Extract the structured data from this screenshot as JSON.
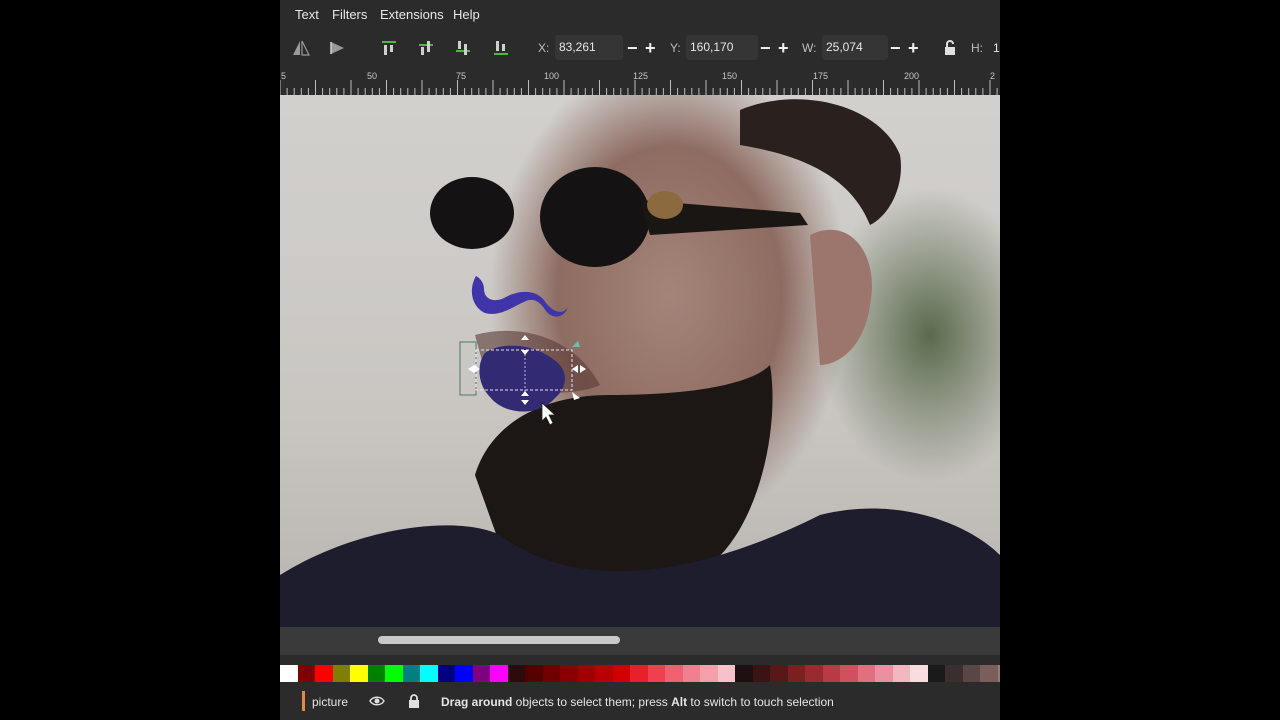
{
  "menu": {
    "items": [
      "Text",
      "Filters",
      "Extensions",
      "Help"
    ]
  },
  "toolbar": {
    "x_label": "X:",
    "x_value": "83,261",
    "y_label": "Y:",
    "y_value": "160,170",
    "w_label": "W:",
    "w_value": "25,074",
    "h_label": "H:",
    "h_value": "1"
  },
  "ruler": {
    "labels": [
      "5",
      "50",
      "75",
      "100",
      "125",
      "150",
      "175",
      "200",
      "2"
    ]
  },
  "canvas": {
    "shape_color": "#322a72",
    "selection_color": "#7a6fd0"
  },
  "palette": {
    "colors": [
      "#ffffff",
      "#800000",
      "#ff0000",
      "#808000",
      "#ffff00",
      "#008000",
      "#00ff00",
      "#008080",
      "#00ffff",
      "#000080",
      "#0000ff",
      "#800080",
      "#ff00ff",
      "#2a0c0c",
      "#550000",
      "#6e0000",
      "#8a0000",
      "#a00000",
      "#b80000",
      "#d00000",
      "#e8202a",
      "#f04050",
      "#f06070",
      "#f08090",
      "#f4a0aa",
      "#f8c0c8",
      "#1e1010",
      "#3a1414",
      "#581818",
      "#7a2020",
      "#9a2a30",
      "#b83a44",
      "#d05060",
      "#e07080",
      "#ea90a0",
      "#f2b8c0",
      "#f8dde0",
      "#1a1a1a",
      "#3a2e2e",
      "#5a4646",
      "#7a5e5e",
      "#9a7878",
      "#ba9696",
      "#d8b8b8",
      "#ecdede",
      "#2a1a12",
      "#4a2a1a"
    ]
  },
  "statusbar": {
    "layer_name": "picture",
    "msg_bold1": "Drag around",
    "msg_text1": " objects to select them; press ",
    "msg_bold2": "Alt",
    "msg_text2": " to switch to touch selection"
  }
}
